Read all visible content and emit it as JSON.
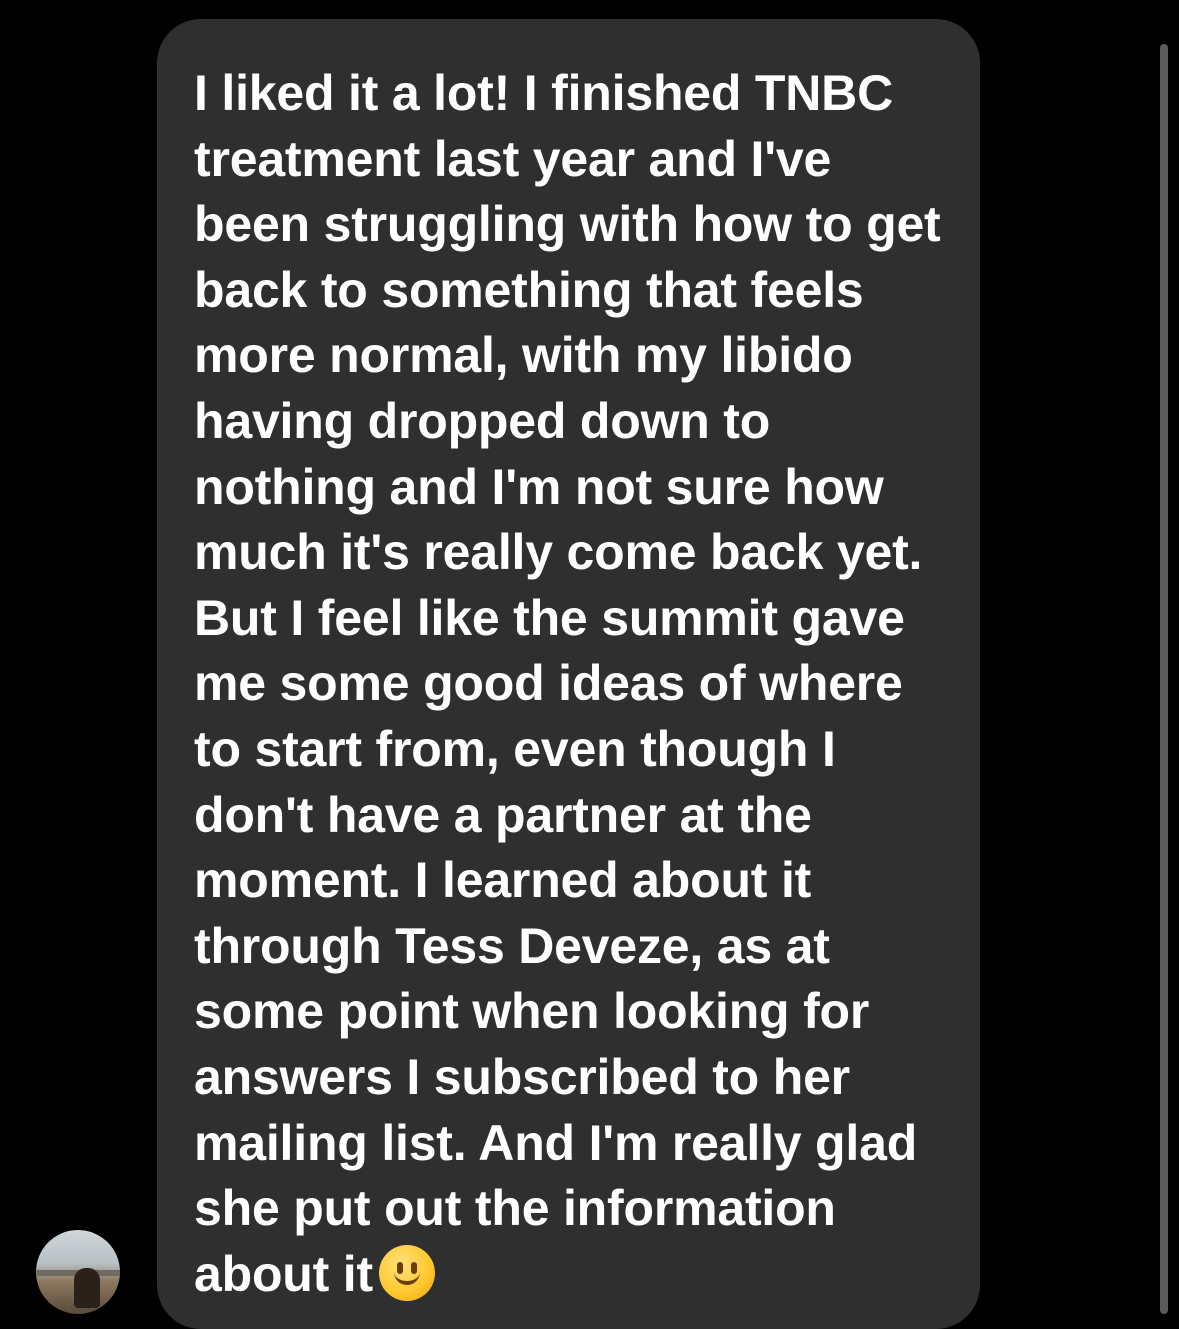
{
  "message": {
    "lines": [
      "I liked it a lot!  I finished TNBC",
      "treatment last year and I've",
      "been struggling with how to get",
      "back to something that feels",
      "more normal, with my libido",
      "having dropped down to",
      "nothing and I'm not sure how",
      "much it's really come back yet.",
      "But I feel like the summit gave",
      "me some good ideas of where",
      "to start from, even though I",
      "don't have a partner at the",
      "moment.  I learned about it",
      "through Tess Deveze, as at",
      "some point when looking for",
      "answers I subscribed to her",
      "mailing list.  And I'm really glad",
      "she put out the information",
      "about it"
    ],
    "emoji": "slightly-smiling-face-icon"
  },
  "colors": {
    "background": "#000000",
    "bubble": "#2f2f2f",
    "text": "#ffffff"
  },
  "avatar": {
    "icon": "sender-avatar"
  }
}
